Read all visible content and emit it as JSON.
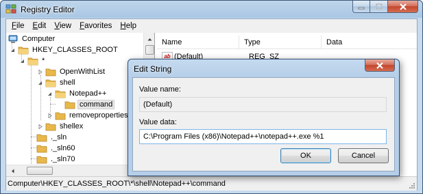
{
  "window": {
    "title": "Registry Editor",
    "icon": "registry-editor-icon"
  },
  "menu": [
    {
      "label": "File",
      "accel": "F",
      "rest": "ile"
    },
    {
      "label": "Edit",
      "accel": "E",
      "rest": "dit"
    },
    {
      "label": "View",
      "accel": "V",
      "rest": "iew"
    },
    {
      "label": "Favorites",
      "accel": "F",
      "rest": "avorites"
    },
    {
      "label": "Help",
      "accel": "H",
      "rest": "elp"
    }
  ],
  "tree": {
    "root": "Computer",
    "hkcr": "HKEY_CLASSES_ROOT",
    "star": "*",
    "openwithlist": "OpenWithList",
    "shell": "shell",
    "notepadpp": "Notepad++",
    "command": "command",
    "removeproperties": "removeproperties",
    "shellex": "shellex",
    "sln": "._sln",
    "sln60": "._sln60",
    "sln70": "._sln70"
  },
  "list": {
    "columns": [
      "Name",
      "Type",
      "Data"
    ],
    "rows": [
      {
        "name": "(Default)",
        "type": "REG_SZ",
        "data": ""
      }
    ]
  },
  "statusbar": {
    "path": "Computer\\HKEY_CLASSES_ROOT\\*\\shell\\Notepad++\\command"
  },
  "dialog": {
    "title": "Edit String",
    "value_name_label": "Value name:",
    "value_name": "(Default)",
    "value_data_label": "Value data:",
    "value_data": "C:\\Program Files (x86)\\Notepad++\\notepad++.exe %1",
    "ok_label": "OK",
    "cancel_label": "Cancel"
  },
  "colors": {
    "titlebar": "#bfd6ec",
    "close_button": "#c3472f",
    "folder": "#e8b84a",
    "selection": "#e6e6e6"
  }
}
